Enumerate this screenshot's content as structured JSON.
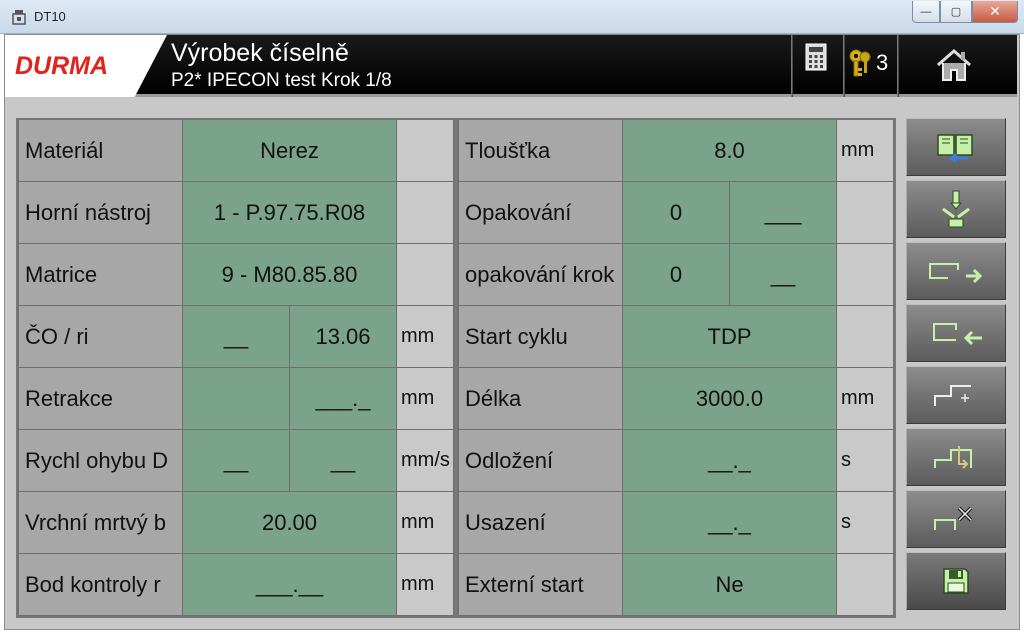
{
  "window": {
    "title": "DT10",
    "minimize": "—",
    "maximize": "▢",
    "close": "✕"
  },
  "header": {
    "logo": "DURMA",
    "title": "Výrobek číselně",
    "subtitle": "P2* IPECON test Krok 1/8",
    "key_count": "3"
  },
  "left_table": [
    {
      "label": "Materiál",
      "cells": [
        "Nerez"
      ],
      "unit": ""
    },
    {
      "label": "Horní nástroj",
      "cells": [
        "1 - P.97.75.R08"
      ],
      "unit": ""
    },
    {
      "label": "Matrice",
      "cells": [
        "9 - M80.85.80"
      ],
      "unit": ""
    },
    {
      "label": "ČO / ri",
      "cells": [
        "__",
        "13.06"
      ],
      "unit": "mm"
    },
    {
      "label": "Retrakce",
      "cells": [
        "",
        "___._"
      ],
      "unit": "mm"
    },
    {
      "label": "Rychl ohybu D",
      "cells": [
        "__",
        "__"
      ],
      "unit": "mm/s"
    },
    {
      "label": "Vrchní mrtvý b",
      "cells": [
        "20.00"
      ],
      "unit": "mm"
    },
    {
      "label": "Bod kontroly r",
      "cells": [
        "___.__"
      ],
      "unit": "mm"
    }
  ],
  "right_table": [
    {
      "label": "Tloušťka",
      "cells": [
        "8.0"
      ],
      "unit": "mm"
    },
    {
      "label": "Opakování",
      "cells": [
        "0",
        "___"
      ],
      "unit": ""
    },
    {
      "label": "opakování krok",
      "cells": [
        "0",
        "__"
      ],
      "unit": ""
    },
    {
      "label": "Start cyklu",
      "cells": [
        "TDP"
      ],
      "unit": ""
    },
    {
      "label": "Délka",
      "cells": [
        "3000.0"
      ],
      "unit": "mm"
    },
    {
      "label": "Odložení",
      "cells": [
        "__._"
      ],
      "unit": "s"
    },
    {
      "label": "Usazení",
      "cells": [
        "__._"
      ],
      "unit": "s"
    },
    {
      "label": "Externí start",
      "cells": [
        "Ne"
      ],
      "unit": ""
    }
  ],
  "colors": {
    "value_green": "#7ba28a",
    "label_gray": "#a7a7a7",
    "logo_red": "#e2221c",
    "icon_green": "#b9e5a0"
  },
  "side_buttons": [
    "book-transfer-icon",
    "tool-punch-icon",
    "bend-forward-icon",
    "bend-back-icon",
    "add-step-icon",
    "insert-step-icon",
    "delete-step-icon",
    "save-icon"
  ]
}
